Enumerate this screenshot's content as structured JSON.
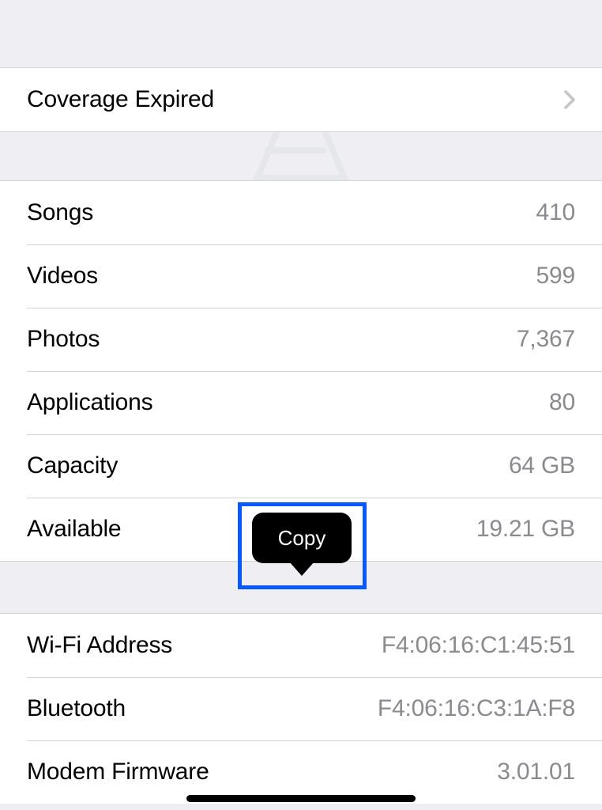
{
  "coverage": {
    "label": "Coverage Expired"
  },
  "stats": {
    "songs": {
      "label": "Songs",
      "value": "410"
    },
    "videos": {
      "label": "Videos",
      "value": "599"
    },
    "photos": {
      "label": "Photos",
      "value": "7,367"
    },
    "applications": {
      "label": "Applications",
      "value": "80"
    },
    "capacity": {
      "label": "Capacity",
      "value": "64 GB"
    },
    "available": {
      "label": "Available",
      "value": "19.21 GB"
    }
  },
  "network": {
    "wifi": {
      "label": "Wi-Fi Address",
      "value": "F4:06:16:C1:45:51"
    },
    "bluetooth": {
      "label": "Bluetooth",
      "value": "F4:06:16:C3:1A:F8"
    },
    "modem": {
      "label": "Modem Firmware",
      "value": "3.01.01"
    }
  },
  "popover": {
    "copy": "Copy"
  }
}
